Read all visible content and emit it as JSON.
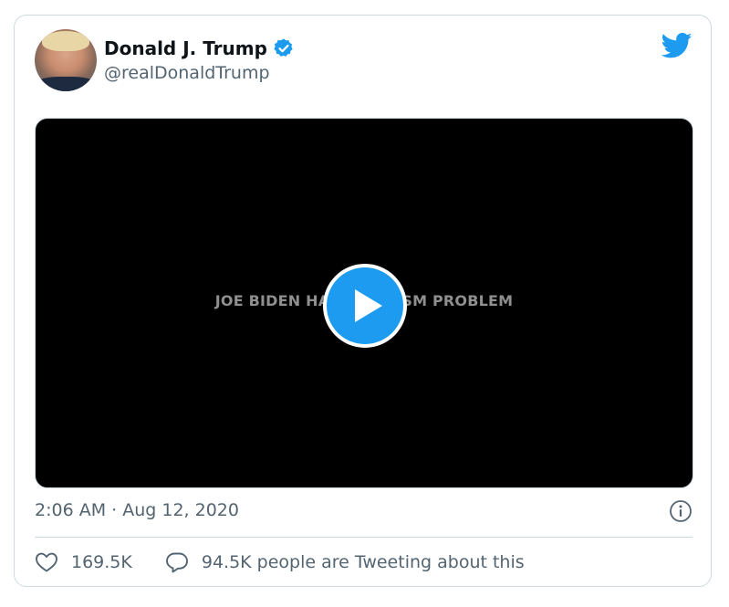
{
  "tweet": {
    "author": {
      "display_name": "Donald J. Trump",
      "handle": "@realDonaldTrump",
      "verified": true
    },
    "media": {
      "type": "video",
      "caption": "JOE BIDEN HAS A RACISM PROBLEM"
    },
    "timestamp": "2:06 AM · Aug 12, 2020",
    "likes": "169.5K",
    "tweeting_about": "94.5K people are Tweeting about this"
  },
  "icons": {
    "brand": "twitter-bird-icon",
    "verified": "verified-badge-icon",
    "play": "play-icon",
    "info": "info-icon",
    "like": "heart-icon",
    "reply": "speech-bubble-icon"
  },
  "colors": {
    "accent": "#1d9bf0",
    "text_primary": "#0f1419",
    "text_secondary": "#536471",
    "border": "#cfd9de",
    "video_background": "#000000"
  }
}
